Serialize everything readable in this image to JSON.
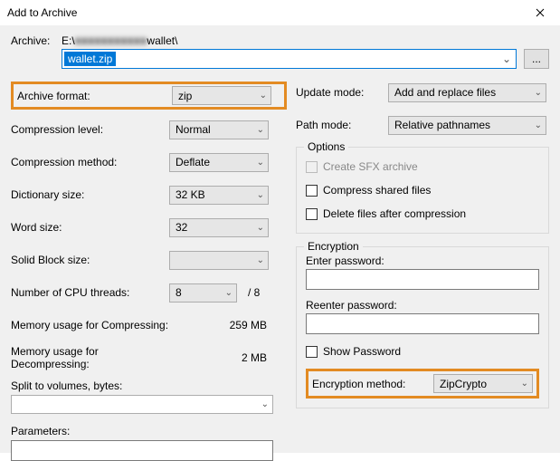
{
  "window": {
    "title": "Add to Archive"
  },
  "archive": {
    "label": "Archive:",
    "path_prefix": "E:\\",
    "path_obscured": "■■■■■■■■■■■",
    "path_suffix": "wallet\\",
    "filename": "wallet.zip",
    "browse": "..."
  },
  "left": {
    "archive_format": {
      "label": "Archive format:",
      "value": "zip"
    },
    "compression_level": {
      "label": "Compression level:",
      "value": "Normal"
    },
    "compression_method": {
      "label": "Compression method:",
      "value": "Deflate"
    },
    "dictionary_size": {
      "label": "Dictionary size:",
      "value": "32 KB"
    },
    "word_size": {
      "label": "Word size:",
      "value": "32"
    },
    "solid_block_size": {
      "label": "Solid Block size:",
      "value": ""
    },
    "cpu_threads": {
      "label": "Number of CPU threads:",
      "value": "8",
      "of": "/ 8"
    },
    "mem_compress": {
      "label": "Memory usage for Compressing:",
      "value": "259 MB"
    },
    "mem_decompress": {
      "label": "Memory usage for Decompressing:",
      "value": "2 MB"
    },
    "split_volumes": {
      "label": "Split to volumes, bytes:",
      "value": ""
    },
    "parameters": {
      "label": "Parameters:",
      "value": ""
    }
  },
  "right": {
    "update_mode": {
      "label": "Update mode:",
      "value": "Add and replace files"
    },
    "path_mode": {
      "label": "Path mode:",
      "value": "Relative pathnames"
    },
    "options": {
      "title": "Options",
      "sfx": "Create SFX archive",
      "shared": "Compress shared files",
      "delete_after": "Delete files after compression"
    },
    "encryption": {
      "title": "Encryption",
      "enter_password": "Enter password:",
      "reenter_password": "Reenter password:",
      "show_password": "Show Password",
      "method_label": "Encryption method:",
      "method_value": "ZipCrypto"
    }
  }
}
